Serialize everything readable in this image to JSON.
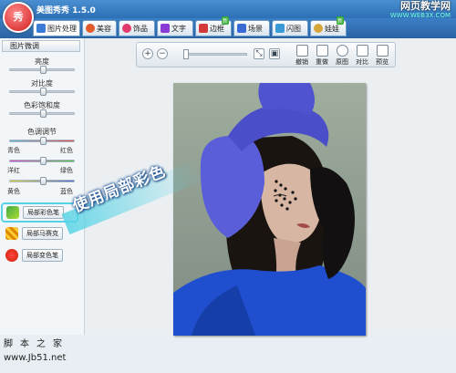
{
  "app": {
    "title": "美图秀秀 1.5.0",
    "logo_text": "秀"
  },
  "watermark_top": {
    "line1": "网页教学网",
    "line2": "WWW.WEB3X.COM"
  },
  "tabs": [
    {
      "label": "图片处理",
      "icon": "image-edit-icon",
      "color": "#3a7bd5",
      "active": true
    },
    {
      "label": "美容",
      "icon": "face-icon",
      "color": "#e05a2a"
    },
    {
      "label": "饰品",
      "icon": "heart-icon",
      "color": "#e23a6a"
    },
    {
      "label": "文字",
      "icon": "text-icon",
      "color": "#8a3ad5"
    },
    {
      "label": "边框",
      "icon": "frame-icon",
      "color": "#d53a3a",
      "badge": "新"
    },
    {
      "label": "场景",
      "icon": "scene-icon",
      "color": "#3a6ad5"
    },
    {
      "label": "闪图",
      "icon": "flash-icon",
      "color": "#3a9ad5"
    },
    {
      "label": "娃娃",
      "icon": "doll-icon",
      "color": "#d5a53a",
      "badge": "新"
    }
  ],
  "left_panel": {
    "header": "图片微调",
    "brightness_label": "亮度",
    "contrast_label": "对比度",
    "saturation_label": "色彩饱和度",
    "color_adjust_label": "色调调节",
    "cyan": "青色",
    "red": "红色",
    "magenta": "洋红",
    "green": "绿色",
    "yellow": "黄色",
    "blue": "蓝色",
    "tools": [
      {
        "label": "局部彩色笔",
        "icon": "color-brush-icon"
      },
      {
        "label": "局部马赛克",
        "icon": "mosaic-icon"
      },
      {
        "label": "局部变色笔",
        "icon": "recolor-brush-icon"
      }
    ]
  },
  "toolbar": {
    "zoom_in": "+",
    "zoom_out": "−",
    "actions": [
      {
        "label": "撤销",
        "icon": "undo-icon"
      },
      {
        "label": "重做",
        "icon": "redo-icon"
      },
      {
        "label": "原图",
        "icon": "original-icon"
      },
      {
        "label": "对比",
        "icon": "compare-icon"
      },
      {
        "label": "预览",
        "icon": "preview-icon"
      }
    ]
  },
  "callout": "使用局部彩色",
  "footer_watermark": {
    "line1": "脚本之家",
    "line2": "www.Jb51.net"
  }
}
